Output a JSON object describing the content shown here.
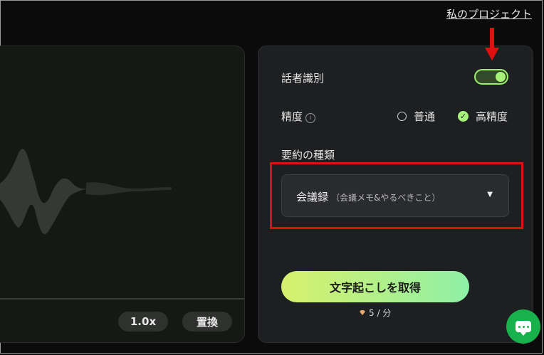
{
  "header": {
    "project_link": "私のプロジェクト"
  },
  "player": {
    "speed_label": "1.0x",
    "replace_label": "置換"
  },
  "settings": {
    "speaker_label": "話者識別",
    "speaker_enabled": true,
    "accuracy_label": "精度",
    "accuracy_options": [
      "普通",
      "高精度"
    ],
    "accuracy_selected": "高精度",
    "summary_type_label": "要約の種類",
    "summary_select_value": "会議録",
    "summary_select_note": "（会議メモ&やるべきこと）"
  },
  "action": {
    "transcribe_label": "文字起こしを取得",
    "cost_label": "5 / 分"
  },
  "icons": {
    "info": "info-icon",
    "caret": "caret-down-icon",
    "chat": "chat-icon",
    "arrow": "red-arrow-annotation",
    "gem": "gem-icon"
  },
  "colors": {
    "accent": "#a6f27a",
    "highlight": "#e01010",
    "chat": "#18b24c"
  }
}
